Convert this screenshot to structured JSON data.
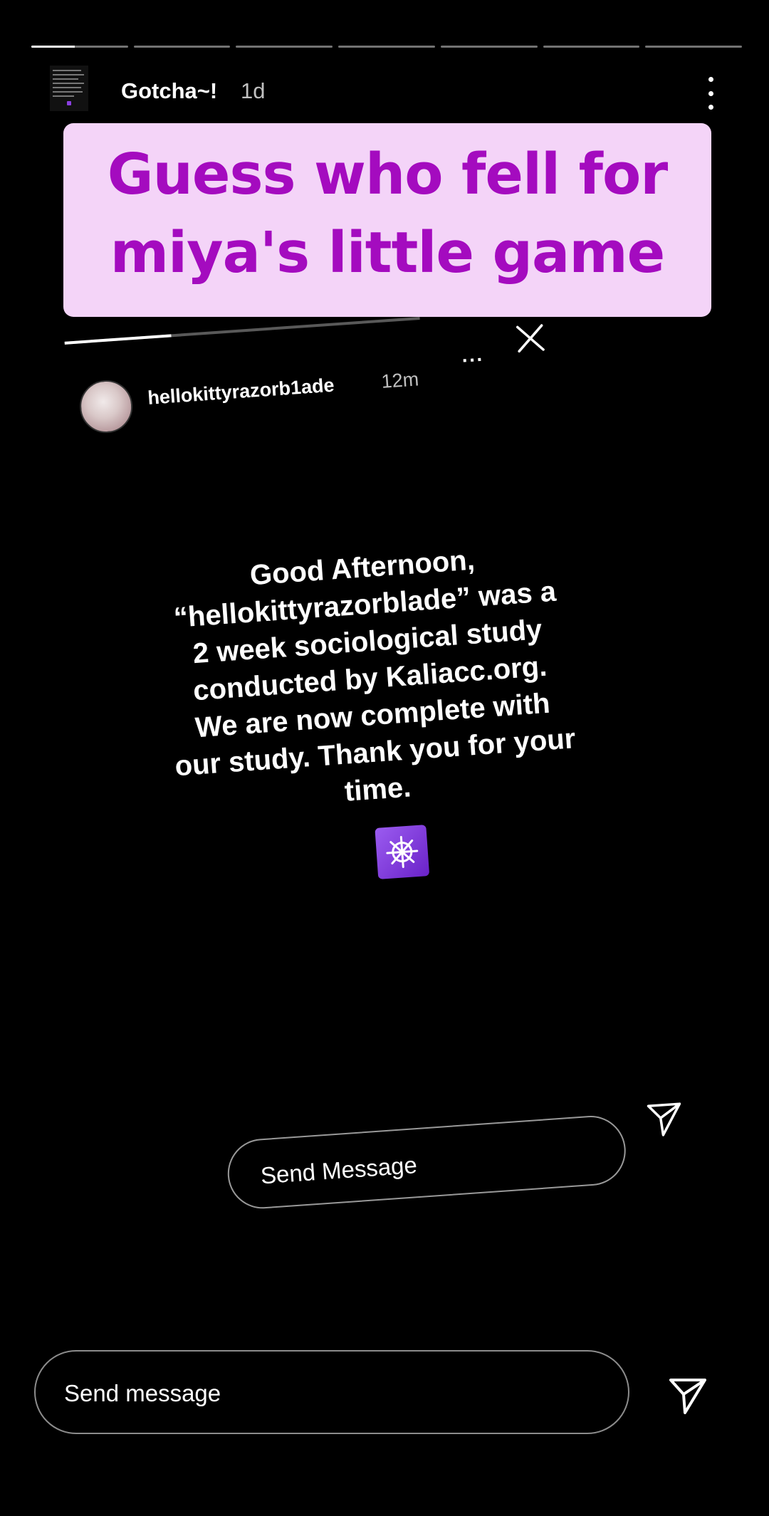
{
  "story": {
    "progress_segments": 7,
    "current_segment_index": 0,
    "current_segment_progress": 0.45,
    "username": "Gotcha~!",
    "age": "1d",
    "more_icon": "more-vert-icon"
  },
  "banner": {
    "line1": "Guess who fell for",
    "line2": "miya's little game",
    "background": "#f4d4f8",
    "text_color": "#a40bbf"
  },
  "screenshot": {
    "username": "hellokittyrazorb1ade",
    "age": "12m",
    "more_label": "···",
    "message_lines": [
      "Good Afternoon,",
      "“hellokittyrazorblade” was a",
      "2 week sociological study",
      "conducted by Kaliacc.org.",
      "We are now complete with",
      "our study. Thank you for your",
      "time."
    ],
    "emoji": "wheel-of-dharma-emoji",
    "emoji_colors": [
      "#9b5cf0",
      "#6a22c8"
    ],
    "input_placeholder": "Send Message",
    "send_icon": "send-icon"
  },
  "reply": {
    "placeholder": "Send message",
    "send_icon": "send-icon"
  }
}
